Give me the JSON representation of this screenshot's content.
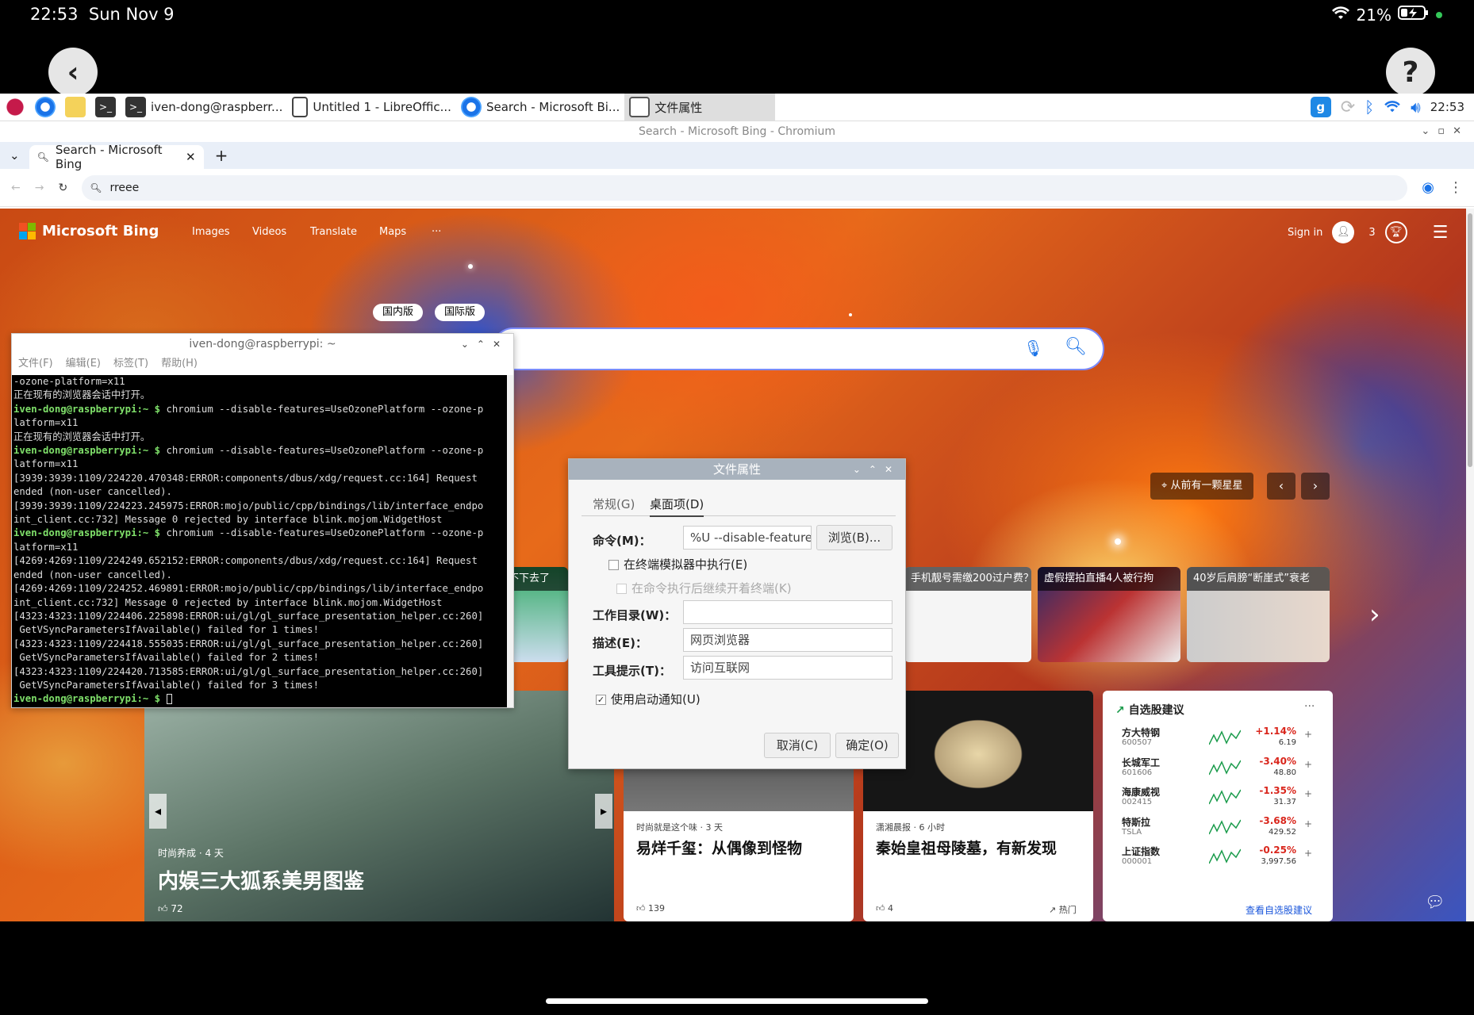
{
  "status_bar": {
    "time": "22:53",
    "date": "Sun Nov 9",
    "battery": "21%"
  },
  "taskbar": {
    "items": [
      {
        "label": "iven-dong@raspberr..."
      },
      {
        "label": "Untitled 1 - LibreOffic..."
      },
      {
        "label": "Search - Microsoft Bi..."
      },
      {
        "label": "文件属性"
      }
    ],
    "clock": "22:53"
  },
  "chrome": {
    "window_title": "Search - Microsoft Bing - Chromium",
    "tab_label": "Search - Microsoft Bing",
    "address": "rreee"
  },
  "bing": {
    "logo": "Microsoft Bing",
    "nav": [
      "Images",
      "Videos",
      "Translate",
      "Maps",
      "···"
    ],
    "sign_in": "Sign in",
    "rewards": "3",
    "tabs_behind": [
      "国内版",
      "国际版"
    ],
    "wallpaper_label": "从前有一颗星星",
    "suggestions": [
      "忍不下去了",
      "手机靓号需缴200过户费？",
      "虚假摆拍直播4人被行拘",
      "40岁后肩膀“断崖式”衰老"
    ],
    "hero": {
      "source": "时尚养成 · 4 天",
      "title": "内娱三大狐系美男图鉴",
      "likes": "72"
    },
    "news": [
      {
        "source": "时尚就是这个味 · 3 天",
        "title": "易烊千玺：从偶像到怪物",
        "likes": "139"
      },
      {
        "source": "潇湘晨报 · 6 小时",
        "title": "秦始皇祖母陵墓，有新发现",
        "likes": "4",
        "tag": "热门"
      }
    ],
    "stocks": {
      "title": "自选股建议",
      "more": "···",
      "rows": [
        {
          "name": "方大特钢",
          "code": "600507",
          "change": "+1.14%",
          "price": "6.19",
          "color": "#d9261c"
        },
        {
          "name": "长城军工",
          "code": "601606",
          "change": "-3.40%",
          "price": "48.80",
          "color": "#d9261c"
        },
        {
          "name": "海康威视",
          "code": "002415",
          "change": "-1.35%",
          "price": "31.37",
          "color": "#d9261c"
        },
        {
          "name": "特斯拉",
          "code": "TSLA",
          "change": "-3.68%",
          "price": "429.52",
          "color": "#d9261c"
        },
        {
          "name": "上证指数",
          "code": "000001",
          "change": "-0.25%",
          "price": "3,997.56",
          "color": "#d9261c"
        }
      ],
      "footer": "查看自选股建议"
    }
  },
  "terminal": {
    "title": "iven-dong@raspberrypi: ~",
    "menu": [
      "文件(F)",
      "编辑(E)",
      "标签(T)",
      "帮助(H)"
    ],
    "lines": [
      {
        "p": "",
        "t": "-ozone-platform=x11"
      },
      {
        "p": "",
        "t": "正在现有的浏览器会话中打开。"
      },
      {
        "p": "iven-dong@raspberrypi:~ $ ",
        "t": "chromium --disable-features=UseOzonePlatform --ozone-p"
      },
      {
        "p": "",
        "t": "latform=x11"
      },
      {
        "p": "",
        "t": "正在现有的浏览器会话中打开。"
      },
      {
        "p": "iven-dong@raspberrypi:~ $ ",
        "t": "chromium --disable-features=UseOzonePlatform --ozone-p"
      },
      {
        "p": "",
        "t": "latform=x11"
      },
      {
        "p": "",
        "t": "[3939:3939:1109/224220.470348:ERROR:components/dbus/xdg/request.cc:164] Request"
      },
      {
        "p": "",
        "t": "ended (non-user cancelled)."
      },
      {
        "p": "",
        "t": "[3939:3939:1109/224223.245975:ERROR:mojo/public/cpp/bindings/lib/interface_endpo"
      },
      {
        "p": "",
        "t": "int_client.cc:732] Message 0 rejected by interface blink.mojom.WidgetHost"
      },
      {
        "p": "iven-dong@raspberrypi:~ $ ",
        "t": "chromium --disable-features=UseOzonePlatform --ozone-p"
      },
      {
        "p": "",
        "t": "latform=x11"
      },
      {
        "p": "",
        "t": "[4269:4269:1109/224249.652152:ERROR:components/dbus/xdg/request.cc:164] Request"
      },
      {
        "p": "",
        "t": "ended (non-user cancelled)."
      },
      {
        "p": "",
        "t": "[4269:4269:1109/224252.469891:ERROR:mojo/public/cpp/bindings/lib/interface_endpo"
      },
      {
        "p": "",
        "t": "int_client.cc:732] Message 0 rejected by interface blink.mojom.WidgetHost"
      },
      {
        "p": "",
        "t": "[4323:4323:1109/224406.225898:ERROR:ui/gl/gl_surface_presentation_helper.cc:260]"
      },
      {
        "p": "",
        "t": " GetVSyncParametersIfAvailable() failed for 1 times!"
      },
      {
        "p": "",
        "t": "[4323:4323:1109/224418.555035:ERROR:ui/gl/gl_surface_presentation_helper.cc:260]"
      },
      {
        "p": "",
        "t": " GetVSyncParametersIfAvailable() failed for 2 times!"
      },
      {
        "p": "",
        "t": "[4323:4323:1109/224420.713585:ERROR:ui/gl/gl_surface_presentation_helper.cc:260]"
      },
      {
        "p": "",
        "t": " GetVSyncParametersIfAvailable() failed for 3 times!"
      },
      {
        "p": "iven-dong@raspberrypi:~ $ ",
        "t": ""
      }
    ]
  },
  "dialog": {
    "title": "文件属性",
    "tabs": [
      "常规(G)",
      "桌面项(D)"
    ],
    "command_label": "命令(M)：",
    "command_value": "%U --disable-features",
    "browse": "浏览(B)...",
    "run_in_terminal": "在终端模拟器中执行(E)",
    "keep_terminal": "在命令执行后继续开着终端(K)",
    "workdir_label": "工作目录(W)：",
    "workdir_value": "",
    "desc_label": "描述(E)：",
    "desc_value": "网页浏览器",
    "tooltip_label": "工具提示(T)：",
    "tooltip_value": "访问互联网",
    "startup_notify": "使用启动通知(U)",
    "cancel": "取消(C)",
    "ok": "确定(O)"
  }
}
